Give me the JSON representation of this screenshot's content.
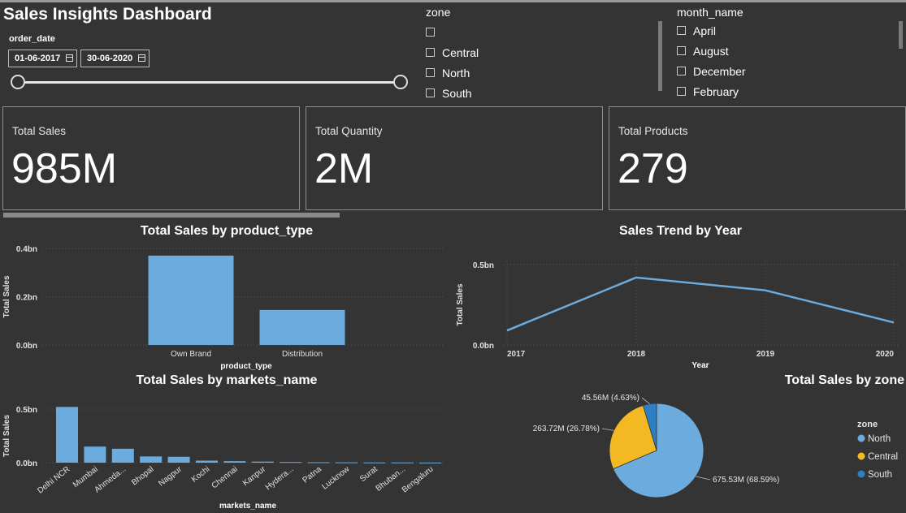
{
  "header": {
    "title": "Sales Insights Dashboard"
  },
  "order_date": {
    "label": "order_date",
    "start": "01-06-2017",
    "end": "30-06-2020"
  },
  "zone_slicer": {
    "label": "zone",
    "items": [
      "",
      "Central",
      "North",
      "South"
    ]
  },
  "month_slicer": {
    "label": "month_name",
    "items": [
      "April",
      "August",
      "December",
      "February"
    ]
  },
  "kpis": [
    {
      "label": "Total Sales",
      "value": "985M"
    },
    {
      "label": "Total Quantity",
      "value": "2M"
    },
    {
      "label": "Total Products",
      "value": "279"
    }
  ],
  "colors": {
    "bar": "#6cabdd",
    "north": "#6cabdd",
    "central": "#f4b922",
    "south": "#2e7ec4",
    "background": "#343434"
  },
  "chart_data": [
    {
      "type": "bar",
      "title": "Total Sales by product_type",
      "xlabel": "product_type",
      "ylabel": "Total Sales",
      "categories": [
        "Own Brand",
        "Distribution"
      ],
      "values": [
        0.37,
        0.145
      ],
      "yticks": [
        "0.0bn",
        "0.2bn",
        "0.4bn"
      ],
      "ylim": [
        0,
        0.4
      ]
    },
    {
      "type": "line",
      "title": "Sales Trend by Year",
      "xlabel": "Year",
      "ylabel": "Total Sales",
      "x": [
        "2017",
        "2018",
        "2019",
        "2020"
      ],
      "values": [
        0.09,
        0.42,
        0.34,
        0.14
      ],
      "yticks": [
        "0.0bn",
        "0.5bn"
      ],
      "ylim": [
        0,
        0.5
      ]
    },
    {
      "type": "bar",
      "title": "Total Sales by markets_name",
      "xlabel": "markets_name",
      "ylabel": "Total Sales",
      "categories": [
        "Delhi NCR",
        "Mumbai",
        "Ahmeda...",
        "Bhopal",
        "Nagpur",
        "Kochi",
        "Chennai",
        "Kanpur",
        "Hydera...",
        "Patna",
        "Lucknow",
        "Surat",
        "Bhuban...",
        "Bengaluru"
      ],
      "values": [
        0.52,
        0.15,
        0.13,
        0.058,
        0.055,
        0.019,
        0.014,
        0.01,
        0.006,
        0.004,
        0.003,
        0.002,
        0.002,
        0.001
      ],
      "yticks": [
        "0.0bn",
        "0.5bn"
      ],
      "ylim": [
        0,
        0.5
      ]
    },
    {
      "type": "pie",
      "title": "Total Sales by zone",
      "legend_title": "zone",
      "legend_position": "right",
      "slices": [
        {
          "name": "North",
          "value": 675.53,
          "label": "675.53M (68.59%)"
        },
        {
          "name": "Central",
          "value": 263.72,
          "label": "263.72M (26.78%)"
        },
        {
          "name": "South",
          "value": 45.56,
          "label": "45.56M (4.63%)"
        }
      ]
    }
  ]
}
